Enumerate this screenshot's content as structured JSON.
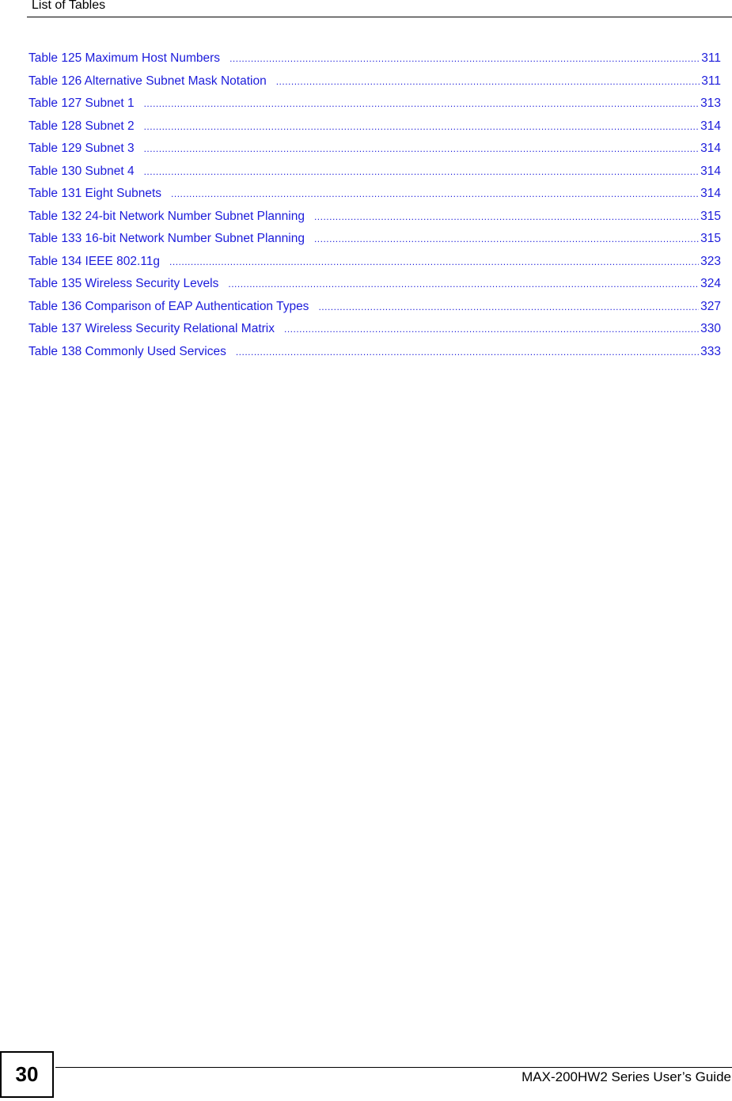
{
  "header": {
    "title": "List of Tables"
  },
  "toc": {
    "leader": "..................................................................................................................................................................................................................",
    "entries": [
      {
        "title": "Table 125 Maximum Host Numbers",
        "page": "311"
      },
      {
        "title": "Table 126 Alternative Subnet Mask Notation",
        "page": "311"
      },
      {
        "title": "Table 127 Subnet 1",
        "page": "313"
      },
      {
        "title": "Table 128 Subnet 2",
        "page": "314"
      },
      {
        "title": "Table 129 Subnet 3",
        "page": "314"
      },
      {
        "title": "Table 130 Subnet 4",
        "page": "314"
      },
      {
        "title": "Table 131 Eight Subnets",
        "page": "314"
      },
      {
        "title": "Table 132 24-bit Network Number Subnet Planning",
        "page": "315"
      },
      {
        "title": "Table 133 16-bit Network Number Subnet Planning",
        "page": "315"
      },
      {
        "title": "Table 134 IEEE 802.11g",
        "page": "323"
      },
      {
        "title": "Table 135 Wireless Security Levels",
        "page": "324"
      },
      {
        "title": "Table 136 Comparison of EAP Authentication Types",
        "page": "327"
      },
      {
        "title": "Table 137 Wireless Security Relational Matrix",
        "page": "330"
      },
      {
        "title": "Table 138 Commonly Used Services",
        "page": "333"
      }
    ]
  },
  "footer": {
    "page_number": "30",
    "guide_title": "MAX-200HW2 Series User’s Guide"
  },
  "colors": {
    "link": "#1c1cdb",
    "text": "#000000"
  }
}
